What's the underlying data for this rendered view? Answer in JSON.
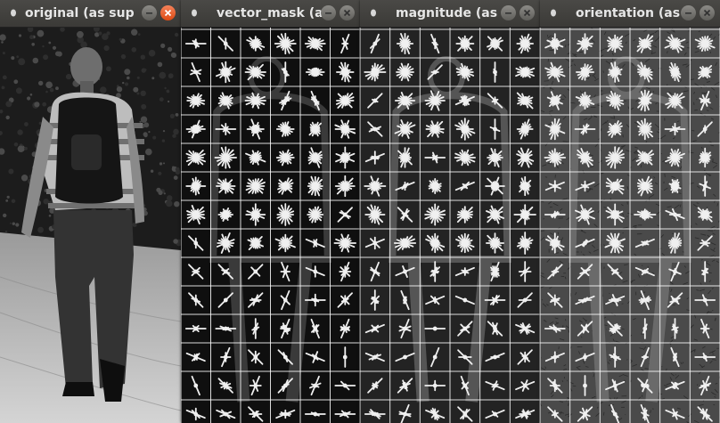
{
  "windows": [
    {
      "id": "original",
      "title": "original (as sup",
      "close_style": "active"
    },
    {
      "id": "vector_mask",
      "title": "vector_mask (a",
      "close_style": "inactive"
    },
    {
      "id": "magnitude",
      "title": "magnitude (as",
      "close_style": "inactive"
    },
    {
      "id": "orientation",
      "title": "orientation (as",
      "close_style": "inactive"
    }
  ],
  "colors": {
    "titlebar": "#3c3b37",
    "title_text": "#e6e6e6",
    "close_active": "#e95420",
    "grid_line": "#ffffff",
    "glyph_stroke": "#f0f0f0"
  },
  "grid": {
    "columns": 6,
    "rows": 14
  },
  "icons": {
    "window_menu": "window-menu-icon",
    "minimize": "minimize-icon",
    "close": "close-icon"
  }
}
